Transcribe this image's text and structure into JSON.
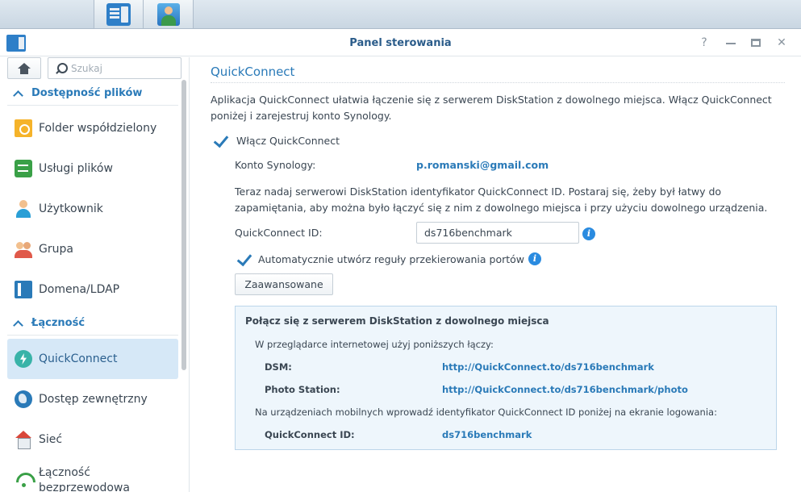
{
  "window": {
    "title": "Panel sterowania",
    "help_glyph": "?",
    "close_glyph": "✕"
  },
  "taskbar": {
    "items": [
      {
        "icon": "main-menu-grid-icon"
      },
      {
        "icon": "control-panel-icon"
      },
      {
        "icon": "user-contacts-icon"
      }
    ]
  },
  "sidebar": {
    "search": {
      "placeholder": "Szukaj",
      "value": ""
    },
    "sections": [
      {
        "label": "Dostępność plików",
        "items": [
          {
            "label": "Folder współdzielony",
            "icon": "shared-folder-icon"
          },
          {
            "label": "Usługi plików",
            "icon": "file-services-icon"
          },
          {
            "label": "Użytkownik",
            "icon": "user-icon"
          },
          {
            "label": "Grupa",
            "icon": "group-icon"
          },
          {
            "label": "Domena/LDAP",
            "icon": "domain-ldap-icon"
          }
        ]
      },
      {
        "label": "Łączność",
        "items": [
          {
            "label": "QuickConnect",
            "icon": "quickconnect-icon",
            "active": true
          },
          {
            "label": "Dostęp zewnętrzny",
            "icon": "external-access-icon"
          },
          {
            "label": "Sieć",
            "icon": "network-icon"
          },
          {
            "label": "Łączność bezprzewodowa",
            "icon": "wireless-icon"
          }
        ]
      }
    ]
  },
  "main": {
    "title": "QuickConnect",
    "description": "Aplikacja QuickConnect ułatwia łączenie się z serwerem DiskStation z dowolnego miejsca. Włącz QuickConnect poniżej i zarejestruj konto Synology.",
    "enable_label": "Włącz QuickConnect",
    "enable_checked": true,
    "account_label": "Konto Synology:",
    "account_value": "p.romanski@gmail.com",
    "id_hint": "Teraz nadaj serwerowi DiskStation identyfikator QuickConnect ID. Postaraj się, żeby był łatwy do zapamiętania, aby można było łączyć się z nim z dowolnego miejsca i przy użyciu dowolnego urządzenia.",
    "id_label": "QuickConnect ID:",
    "id_value": "ds716benchmark",
    "auto_rules_label": "Automatycznie utwórz reguły przekierowania portów",
    "auto_rules_checked": true,
    "advanced_button": "Zaawansowane",
    "info_box": {
      "title": "Połącz się z serwerem DiskStation z dowolnego miejsca",
      "browser_text": "W przeglądarce internetowej użyj poniższych łączy:",
      "dsm_label": "DSM:",
      "dsm_link": "http://QuickConnect.to/ds716benchmark",
      "photo_label": "Photo Station:",
      "photo_link": "http://QuickConnect.to/ds716benchmark/photo",
      "mobile_text": "Na urządzeniach mobilnych wprowadź identyfikator QuickConnect ID poniżej na ekranie logowania:",
      "qc_id_label": "QuickConnect ID:",
      "qc_id_value": "ds716benchmark"
    }
  },
  "colors": {
    "accent": "#2a7ab8",
    "active_item_bg": "#d6e8f7",
    "info_box_bg": "#eef6fc"
  }
}
